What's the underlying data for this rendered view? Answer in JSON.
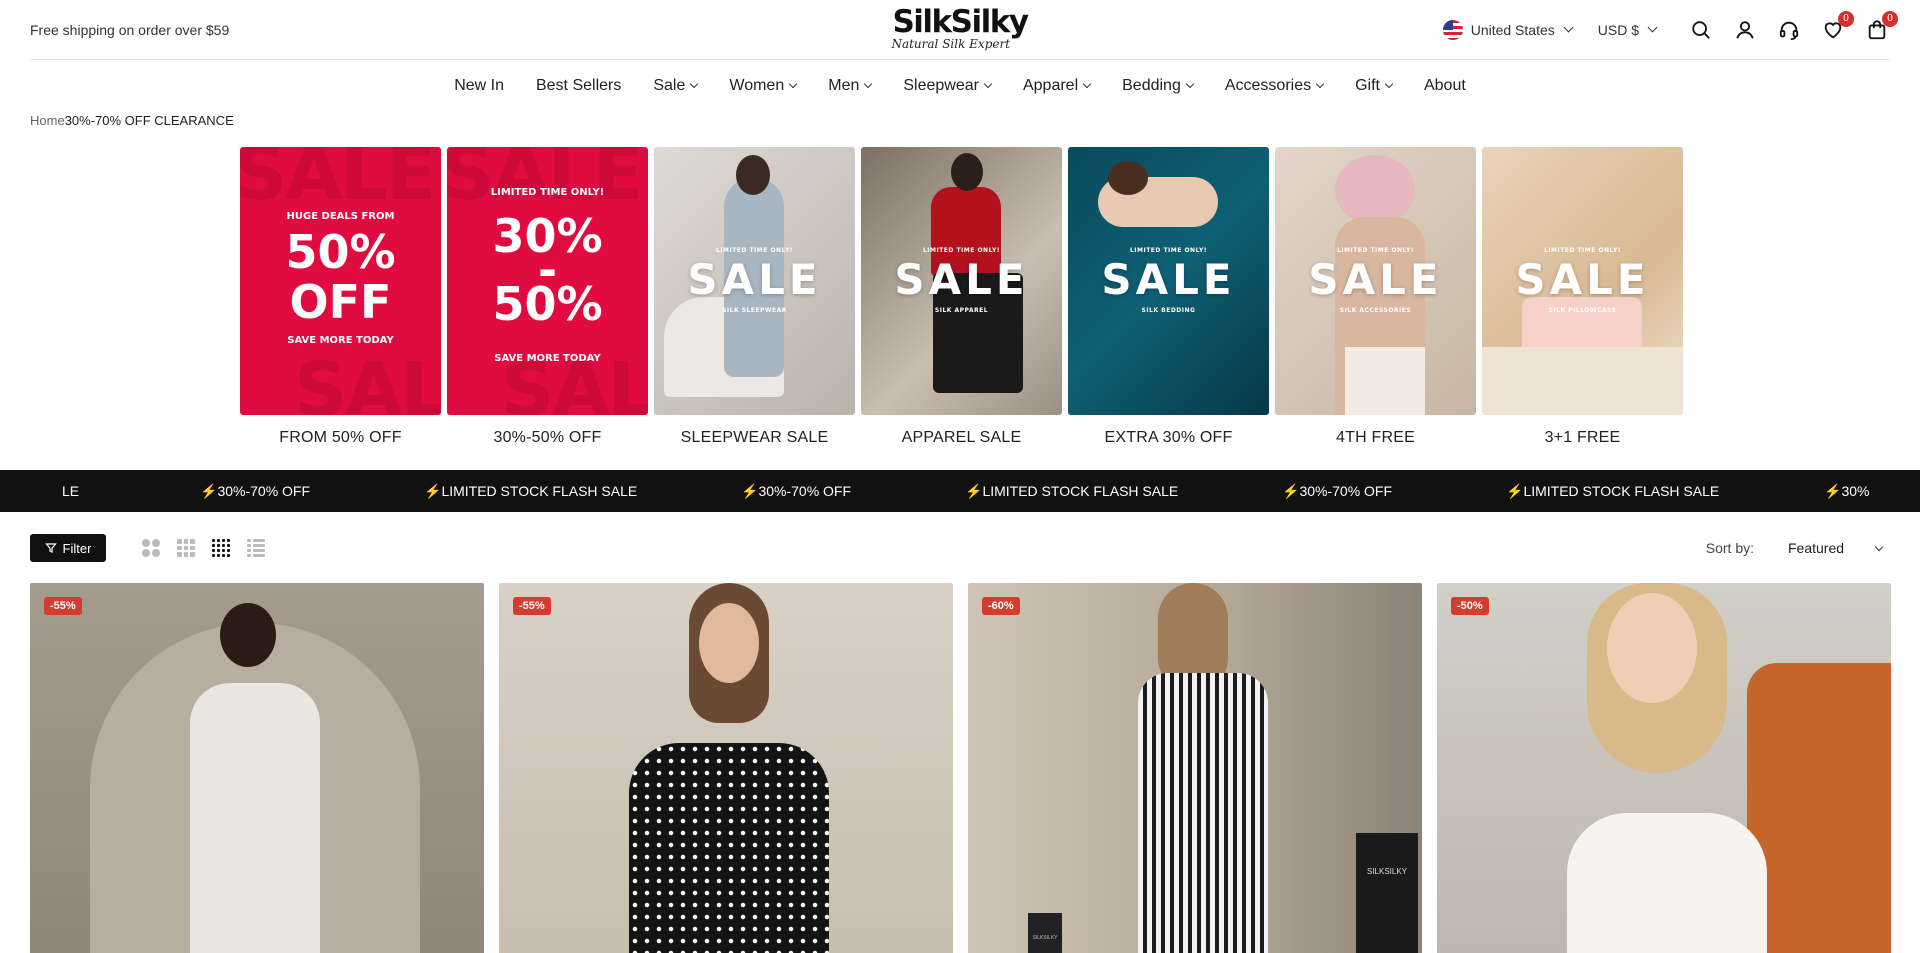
{
  "announcement": "Free shipping on order over $59",
  "brand": {
    "name": "SilkSilky",
    "tagline": "Natural Silk Expert"
  },
  "locale": {
    "country": "United States",
    "currency": "USD $"
  },
  "header_icons": {
    "search": "search-icon",
    "account": "user-icon",
    "support": "headset-icon",
    "wishlist": "heart-icon",
    "wishlist_count": "0",
    "cart": "bag-icon",
    "cart_count": "0"
  },
  "nav": {
    "items": [
      {
        "label": "New In"
      },
      {
        "label": "Best Sellers"
      },
      {
        "label": "Sale"
      },
      {
        "label": "Women"
      },
      {
        "label": "Men"
      },
      {
        "label": "Sleepwear"
      },
      {
        "label": "Apparel"
      },
      {
        "label": "Bedding"
      },
      {
        "label": "Accessories"
      },
      {
        "label": "Gift"
      },
      {
        "label": "About"
      }
    ]
  },
  "breadcrumb": {
    "home": "Home",
    "current": "30%-70% OFF CLEARANCE"
  },
  "categories": [
    {
      "label": "FROM 50% OFF",
      "ghost": "SALE",
      "ghost_bottom": "SAL",
      "top": "HUGE DEALS FROM",
      "line1": "50%",
      "line2": "OFF",
      "bottom": "SAVE MORE TODAY"
    },
    {
      "label": "30%-50% OFF",
      "ghost": "SALE",
      "ghost_bottom": "SAL",
      "top": "LIMITED TIME ONLY!",
      "line1": "30%",
      "line2": "-",
      "line3": "50%",
      "bottom": "SAVE MORE TODAY"
    },
    {
      "label": "SLEEPWEAR SALE",
      "kicker": "LIMITED TIME ONLY!",
      "sale": "SALE",
      "sub": "SILK SLEEPWEAR"
    },
    {
      "label": "APPAREL SALE",
      "kicker": "LIMITED TIME ONLY!",
      "sale": "SALE",
      "sub": "SILK APPAREL"
    },
    {
      "label": "EXTRA 30% OFF",
      "kicker": "LIMITED TIME ONLY!",
      "sale": "SALE",
      "sub": "SILK BEDDING"
    },
    {
      "label": "4TH FREE",
      "kicker": "LIMITED TIME ONLY!",
      "sale": "SALE",
      "sub": "SILK ACCESSORIES"
    },
    {
      "label": "3+1 FREE",
      "kicker": "LIMITED TIME ONLY!",
      "sale": "SALE",
      "sub": "SILK PILLOWCASE"
    }
  ],
  "marquee": {
    "bolt": "⚡",
    "items": [
      "LE",
      "30%-70% OFF",
      "LIMITED STOCK FLASH SALE",
      "30%-70% OFF",
      "LIMITED STOCK FLASH SALE",
      "30%-70% OFF",
      "LIMITED STOCK FLASH SALE",
      "30%"
    ]
  },
  "toolbar": {
    "filter_label": "Filter",
    "sort_label": "Sort by:",
    "sort_value": "Featured",
    "view_modes": [
      "2-columns",
      "3-columns",
      "4-columns",
      "list"
    ],
    "active_view": "4-columns"
  },
  "products": [
    {
      "discount": "-55%"
    },
    {
      "discount": "-55%"
    },
    {
      "discount": "-60%",
      "box_brand": "SILKSILKY",
      "box_brand_small": "SILKSILKY"
    },
    {
      "discount": "-50%"
    }
  ],
  "colors": {
    "sale_red": "#e00c3f",
    "badge_red": "#d63b30",
    "marquee_bg": "#111111",
    "bolt": "#f5c518"
  }
}
